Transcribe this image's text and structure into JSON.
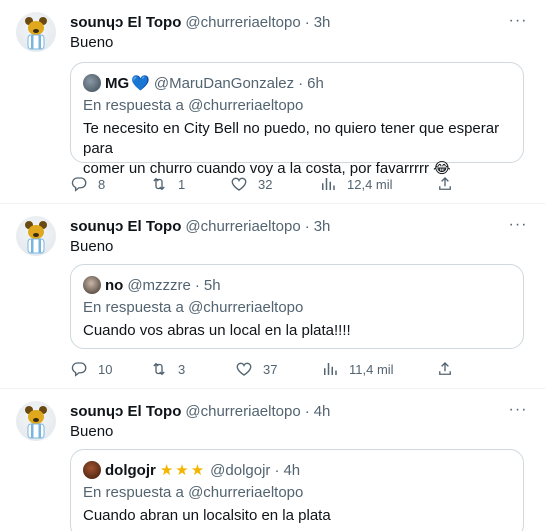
{
  "tweets": [
    {
      "name": "sounɥɔ El Topo",
      "handle": "@churreriaeltopo",
      "time": "3h",
      "text": "Bueno",
      "quote": {
        "name": "MG",
        "name_emoji": "💙",
        "handle": "@MaruDanGonzalez",
        "time": "6h",
        "reply_to": "En respuesta a @churreriaeltopo",
        "text_line1": "Te necesito en City Bell no puedo, no quiero tener que esperar para",
        "text_line2": "comer un churro cuando voy a la costa, por favarrrrr 😂"
      },
      "stats": {
        "replies": "8",
        "retweets": "1",
        "likes": "32",
        "views": "12,4 mil"
      }
    },
    {
      "name": "sounɥɔ El Topo",
      "handle": "@churreriaeltopo",
      "time": "3h",
      "text": "Bueno",
      "quote": {
        "name": "no",
        "handle": "@mzzzre",
        "time": "5h",
        "reply_to": "En respuesta a @churreriaeltopo",
        "text_line1": "Cuando vos abras un local en la plata!!!!"
      },
      "stats": {
        "replies": "10",
        "retweets": "3",
        "likes": "37",
        "views": "11,4 mil"
      }
    },
    {
      "name": "sounɥɔ El Topo",
      "handle": "@churreriaeltopo",
      "time": "4h",
      "text": "Bueno",
      "quote": {
        "name": "dolgojr",
        "name_emoji": "★★★",
        "handle": "@dolgojr",
        "time": "4h",
        "reply_to": "En respuesta a @churreriaeltopo",
        "text_line1": "Cuando abran un localsito en la plata"
      }
    }
  ],
  "ui": {
    "more_glyph": "···",
    "dot": "·"
  },
  "icons": [
    "reply-icon",
    "retweet-icon",
    "like-icon",
    "views-icon",
    "share-icon",
    "more-icon"
  ],
  "colors": {
    "text": "#0f1419",
    "muted": "#536471",
    "border": "#cfd9de",
    "accent": "#1d9bf0"
  }
}
